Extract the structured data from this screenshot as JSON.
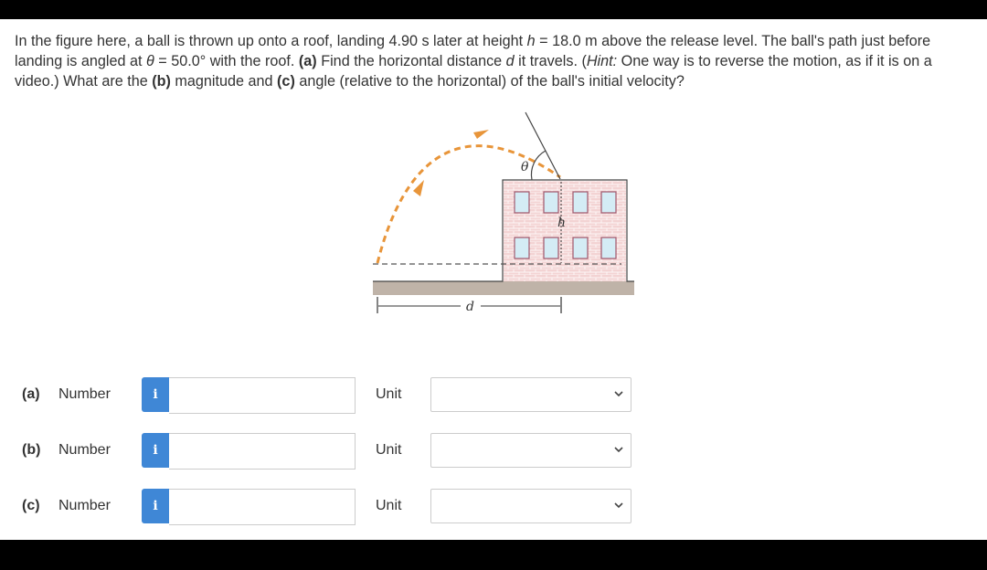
{
  "question": {
    "s1": "In the figure here, a ball is thrown up onto a roof, landing 4.90 s later at height ",
    "h_var": "h",
    "s2": " = 18.0 m above the release level. The ball's path just before landing is angled at ",
    "theta_var": "θ",
    "s3": " = 50.0° with the roof. ",
    "a_tag": "(a)",
    "s4": " Find the horizontal distance ",
    "d_var": "d",
    "s5": " it travels. (",
    "hint": "Hint:",
    "s6": " One way is to reverse the motion, as if it is on a video.) What are the ",
    "b_tag": "(b)",
    "s7": " magnitude and ",
    "c_tag": "(c)",
    "s8": " angle (relative to the horizontal) of the ball's initial velocity?"
  },
  "figure": {
    "theta_label": "θ",
    "h_label": "h",
    "d_label": "d",
    "colors": {
      "path": "#e8953a",
      "brick": "#f3d3d3",
      "ground": "#bfb3a8",
      "window": "#d4ecf5"
    }
  },
  "answers": [
    {
      "part": "(a)",
      "number_label": "Number",
      "info_icon": "i",
      "value": "",
      "unit_label": "Unit",
      "unit_value": ""
    },
    {
      "part": "(b)",
      "number_label": "Number",
      "info_icon": "i",
      "value": "",
      "unit_label": "Unit",
      "unit_value": ""
    },
    {
      "part": "(c)",
      "number_label": "Number",
      "info_icon": "i",
      "value": "",
      "unit_label": "Unit",
      "unit_value": ""
    }
  ]
}
